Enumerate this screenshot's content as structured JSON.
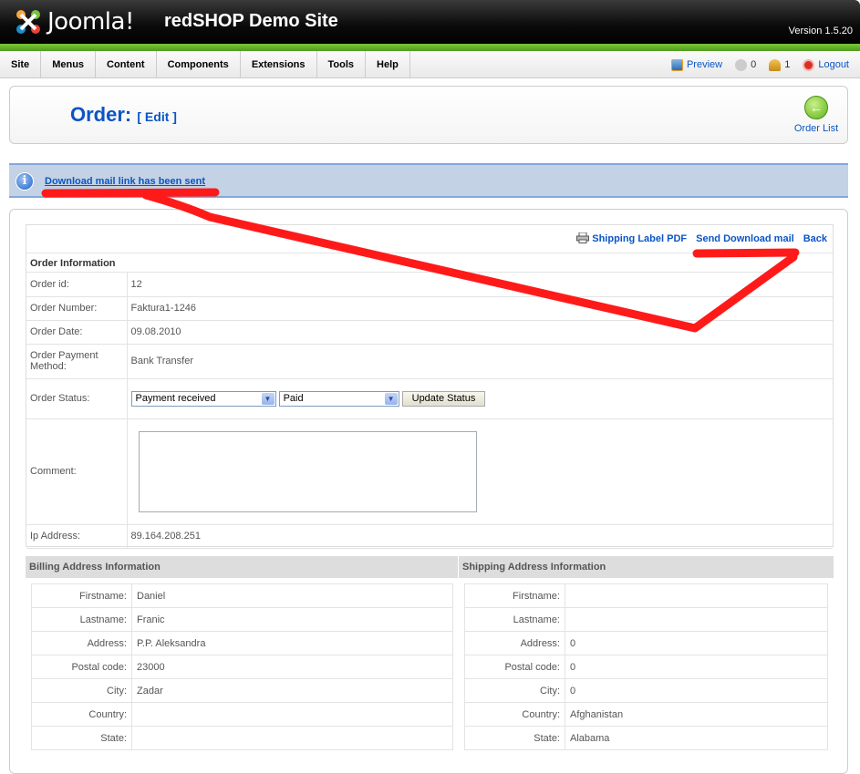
{
  "header": {
    "logo_text": "Joomla!",
    "site_title": "redSHOP Demo Site",
    "version": "Version 1.5.20"
  },
  "menu": {
    "items": [
      "Site",
      "Menus",
      "Content",
      "Components",
      "Extensions",
      "Tools",
      "Help"
    ],
    "preview": "Preview",
    "messages_count": "0",
    "users_count": "1",
    "logout": "Logout"
  },
  "toolbar": {
    "title": "Order:",
    "subtitle": "[ Edit ]",
    "order_list": "Order List"
  },
  "message": {
    "text": "Download mail link has been sent"
  },
  "order": {
    "actions": {
      "shipping_label": "Shipping Label PDF",
      "send_download": "Send Download mail",
      "back": "Back"
    },
    "section_title": "Order Information",
    "rows": [
      {
        "label": "Order id:",
        "value": "12"
      },
      {
        "label": "Order Number:",
        "value": "Faktura1-1246"
      },
      {
        "label": "Order Date:",
        "value": "09.08.2010"
      },
      {
        "label": "Order Payment Method:",
        "value": "Bank Transfer"
      }
    ],
    "status_label": "Order Status:",
    "status_value": "Payment received",
    "payment_value": "Paid",
    "update_button": "Update Status",
    "comment_label": "Comment:",
    "ip_label": "Ip Address:",
    "ip_value": "89.164.208.251"
  },
  "billing": {
    "title": "Billing Address Information",
    "rows": [
      {
        "label": "Firstname:",
        "value": "Daniel"
      },
      {
        "label": "Lastname:",
        "value": "Franic"
      },
      {
        "label": "Address:",
        "value": "P.P. Aleksandra"
      },
      {
        "label": "Postal code:",
        "value": "23000"
      },
      {
        "label": "City:",
        "value": "Zadar"
      },
      {
        "label": "Country:",
        "value": ""
      },
      {
        "label": "State:",
        "value": ""
      }
    ]
  },
  "shipping": {
    "title": "Shipping Address Information",
    "rows": [
      {
        "label": "Firstname:",
        "value": ""
      },
      {
        "label": "Lastname:",
        "value": ""
      },
      {
        "label": "Address:",
        "value": "0"
      },
      {
        "label": "Postal code:",
        "value": "0"
      },
      {
        "label": "City:",
        "value": "0"
      },
      {
        "label": "Country:",
        "value": "Afghanistan"
      },
      {
        "label": "State:",
        "value": "Alabama"
      }
    ]
  },
  "colors": {
    "link": "#0b55c4",
    "annotation": "#ff1a1a",
    "header_green": "#6fbf2a"
  }
}
